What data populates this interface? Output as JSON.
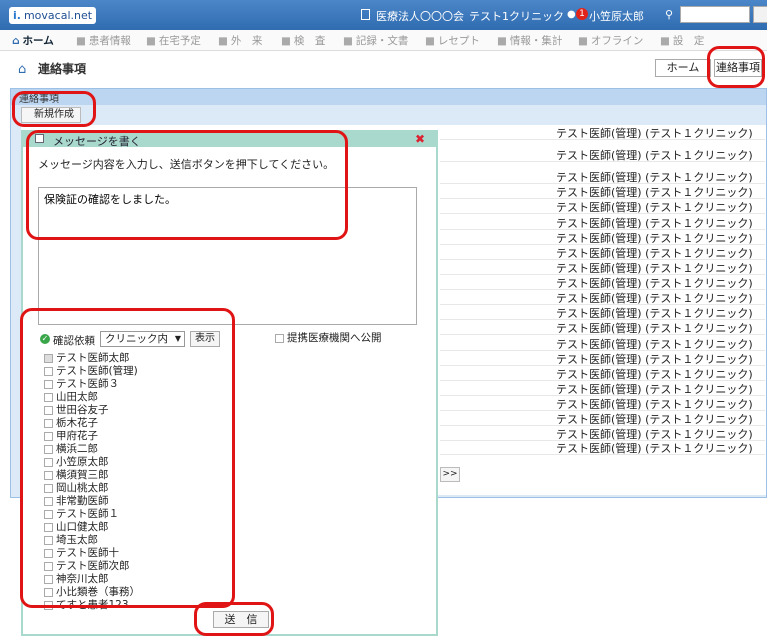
{
  "header": {
    "logo_text": "movacal.net",
    "organization": "医療法人〇〇〇会",
    "clinic": "テスト1クリニック",
    "badge_count": "1",
    "user_name": "小笠原太郎",
    "search_placeholder": ""
  },
  "nav": [
    {
      "label": "ホーム",
      "icon": "home-icon",
      "active": true
    },
    {
      "label": "患者情報",
      "icon": "patient-icon"
    },
    {
      "label": "在宅予定",
      "icon": "clock-icon"
    },
    {
      "label": "外　来",
      "icon": "outpatient-icon"
    },
    {
      "label": "検　査",
      "icon": "test-icon"
    },
    {
      "label": "記録・文書",
      "icon": "document-icon"
    },
    {
      "label": "レセプト",
      "icon": "receipt-icon"
    },
    {
      "label": "情報・集計",
      "icon": "stats-icon"
    },
    {
      "label": "オフライン",
      "icon": "offline-icon"
    },
    {
      "label": "設　定",
      "icon": "settings-icon"
    }
  ],
  "page": {
    "title": "連絡事項",
    "breadcrumb_home": "ホーム",
    "breadcrumb_current": "連絡事項"
  },
  "panel": {
    "header_label": "連絡事項",
    "new_button": "新規作成",
    "pager_next": ">>"
  },
  "list_rows": [
    "テスト医師(管理) (テスト１クリニック)",
    "テスト医師(管理) (テスト１クリニック)",
    "テスト医師(管理) (テスト１クリニック)",
    "テスト医師(管理) (テスト１クリニック)",
    "テスト医師(管理) (テスト１クリニック)",
    "テスト医師(管理) (テスト１クリニック)",
    "テスト医師(管理) (テスト１クリニック)",
    "テスト医師(管理) (テスト１クリニック)",
    "テスト医師(管理) (テスト１クリニック)",
    "テスト医師(管理) (テスト１クリニック)",
    "テスト医師(管理) (テスト１クリニック)",
    "テスト医師(管理) (テスト１クリニック)",
    "テスト医師(管理) (テスト１クリニック)",
    "テスト医師(管理) (テスト１クリニック)",
    "テスト医師(管理) (テスト１クリニック)",
    "テスト医師(管理) (テスト１クリニック)",
    "テスト医師(管理) (テスト１クリニック)",
    "テスト医師(管理) (テスト１クリニック)",
    "テスト医師(管理) (テスト１クリニック)",
    "テスト医師(管理) (テスト１クリニック)",
    "テスト医師(管理) (テスト１クリニック)"
  ],
  "dialog": {
    "title": "メッセージを書く",
    "instruction": "メッセージ内容を入力し、送信ボタンを押下してください。",
    "message": "保険証の確認をしました。",
    "confirm_label": "確認依頼",
    "scope_value": "クリニック内",
    "display_button": "表示",
    "public_label": "提携医療機関へ公開",
    "send_button": "送　信",
    "staff": [
      {
        "name": "テスト医師太郎",
        "checked": true
      },
      {
        "name": "テスト医師(管理)",
        "checked": false
      },
      {
        "name": "テスト医師３",
        "checked": false
      },
      {
        "name": "山田太郎",
        "checked": false
      },
      {
        "name": "世田谷友子",
        "checked": false
      },
      {
        "name": "栃木花子",
        "checked": false
      },
      {
        "name": "甲府花子",
        "checked": false
      },
      {
        "name": "横浜二郎",
        "checked": false
      },
      {
        "name": "小笠原太郎",
        "checked": false
      },
      {
        "name": "横須賀三郎",
        "checked": false
      },
      {
        "name": "岡山桃太郎",
        "checked": false
      },
      {
        "name": "非常勤医師",
        "checked": false
      },
      {
        "name": "テスト医師１",
        "checked": false
      },
      {
        "name": "山口健太郎",
        "checked": false
      },
      {
        "name": "埼玉太郎",
        "checked": false
      },
      {
        "name": "テスト医師十",
        "checked": false
      },
      {
        "name": "テスト医師次郎",
        "checked": false
      },
      {
        "name": "神奈川太郎",
        "checked": false
      },
      {
        "name": "小比類巻（事務）",
        "checked": false
      },
      {
        "name": "てすと患者123",
        "checked": false
      }
    ]
  },
  "colors": {
    "header_blue": "#2f6cb0",
    "dialog_green": "#a9d9cc",
    "annotation_red": "#e01414"
  }
}
